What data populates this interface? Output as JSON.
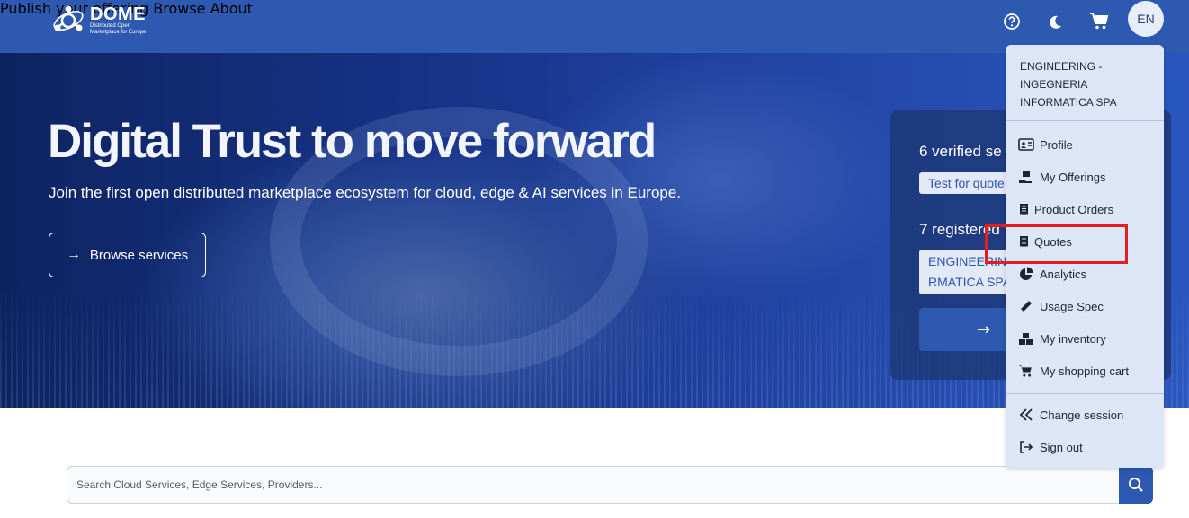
{
  "header": {
    "logo_title": "DOME",
    "logo_subtitle": "Distributed Open Marketplace for Europe",
    "nav": [
      "Publish your offering",
      "Browse",
      "About"
    ],
    "avatar_label": "EN",
    "colors": {
      "header_bg": "#2d59b1"
    }
  },
  "hero": {
    "title": "Digital Trust to move forward",
    "subtitle": "Join the first open distributed marketplace ecosystem for cloud, edge & AI services in Europe.",
    "browse_button": "Browse services"
  },
  "stats": {
    "verified_heading": "6 verified se",
    "verified_chip": "Test for quote",
    "registered_heading": "7 registered",
    "registered_chip_line1": "ENGINEERING",
    "registered_chip_line2": "RMATICA SPA"
  },
  "menu": {
    "organization": "ENGINEERING - INGEGNERIA INFORMATICA SPA",
    "items": [
      {
        "label": "Profile",
        "icon": "id-card-icon"
      },
      {
        "label": "My Offerings",
        "icon": "hand-box-icon"
      },
      {
        "label": "Product Orders",
        "icon": "receipt-icon"
      },
      {
        "label": "Quotes",
        "icon": "receipt-icon"
      },
      {
        "label": "Analytics",
        "icon": "pie-chart-icon"
      },
      {
        "label": "Usage Spec",
        "icon": "ruler-icon"
      },
      {
        "label": "My inventory",
        "icon": "boxes-icon"
      },
      {
        "label": "My shopping cart",
        "icon": "cart-icon"
      }
    ],
    "session_items": [
      {
        "label": "Change session",
        "icon": "double-chevron-left-icon"
      },
      {
        "label": "Sign out",
        "icon": "sign-out-icon"
      }
    ]
  },
  "search": {
    "placeholder": "Search Cloud Services, Edge Services, Providers..."
  }
}
